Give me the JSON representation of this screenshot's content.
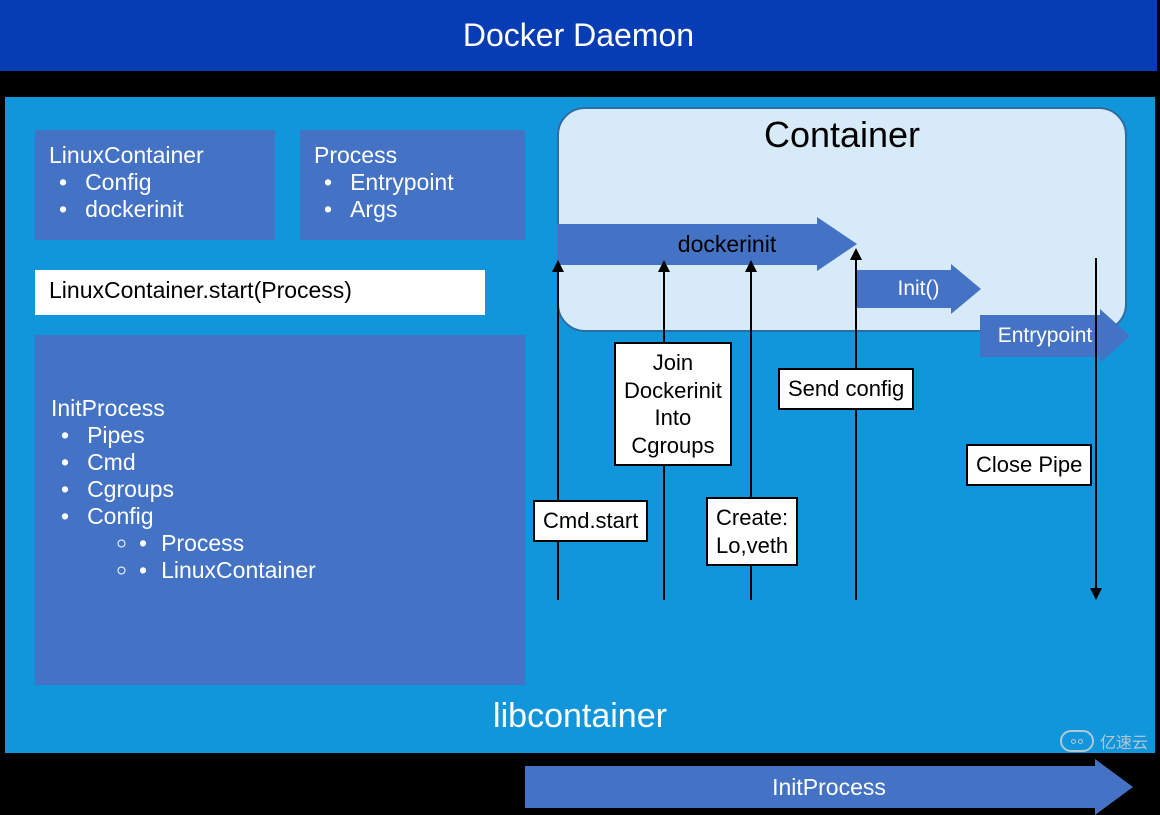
{
  "header": {
    "title": "Docker Daemon"
  },
  "lc_box": {
    "title": "LinuxContainer",
    "items": [
      "Config",
      "dockerinit"
    ]
  },
  "pr_box": {
    "title": "Process",
    "items": [
      "Entrypoint",
      "Args"
    ]
  },
  "start_label": "LinuxContainer.start(Process)",
  "init_box": {
    "title": "InitProcess",
    "items": [
      "Pipes",
      "Cmd",
      "Cgroups",
      "Config"
    ],
    "sub": [
      "Process",
      "LinuxContainer"
    ]
  },
  "container": {
    "title": "Container"
  },
  "flow": {
    "dockerinit": "dockerinit",
    "init_fn": "Init()",
    "entrypoint": "Entrypoint",
    "initprocess": "InitProcess"
  },
  "notes": {
    "cmd_start": "Cmd.start",
    "join": "Join\nDockerinit\nInto\nCgroups",
    "create": "Create:\nLo,veth",
    "send": "Send config",
    "close": "Close Pipe"
  },
  "footer": {
    "lib": "libcontainer"
  },
  "watermark": "亿速云"
}
